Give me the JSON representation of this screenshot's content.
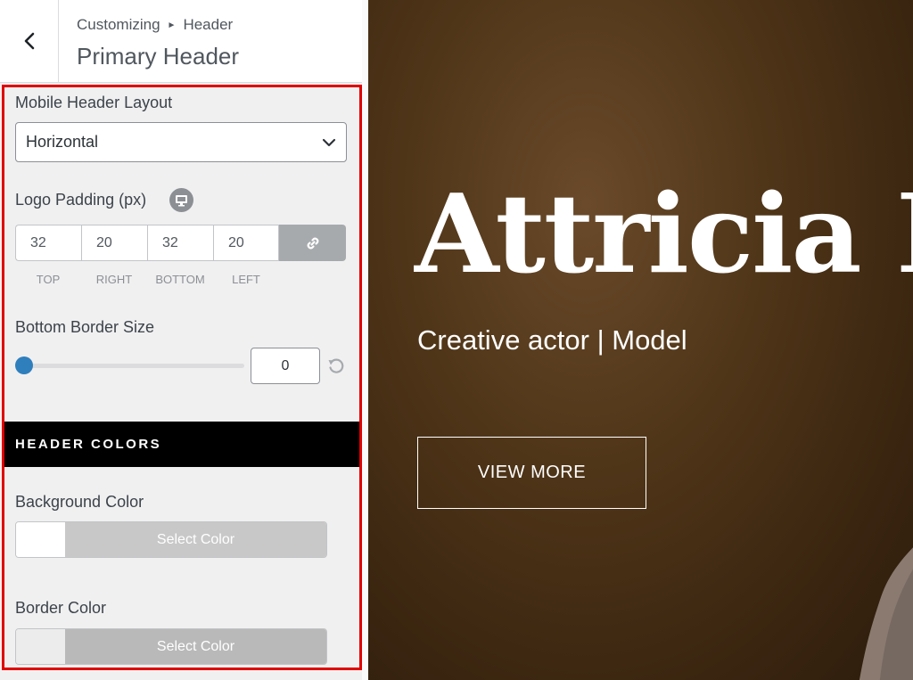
{
  "header": {
    "breadcrumb": [
      "Customizing",
      "Header"
    ],
    "title": "Primary Header"
  },
  "mobile_layout": {
    "label": "Mobile Header Layout",
    "value": "Horizontal"
  },
  "logo_padding": {
    "label": "Logo Padding (px)",
    "top": "32",
    "right": "20",
    "bottom": "32",
    "left": "20",
    "labels": [
      "TOP",
      "RIGHT",
      "BOTTOM",
      "LEFT"
    ]
  },
  "border_size": {
    "label": "Bottom Border Size",
    "value": "0",
    "slider_fraction": 0
  },
  "section": {
    "title": "HEADER COLORS"
  },
  "background_color": {
    "label": "Background Color",
    "button": "Select Color",
    "swatch": "#ffffff",
    "bar_color": "#c8c8c8"
  },
  "border_color": {
    "label": "Border Color",
    "button": "Select Color",
    "swatch": "#ececec",
    "bar_color": "#b9b9b9"
  },
  "preview": {
    "title": "Attricia Ke",
    "subtitle": "Creative actor | Model",
    "button": "VIEW MORE"
  },
  "colors": {
    "highlight": "#e00000",
    "slider_accent": "#2f7fbd",
    "section_bg": "#000000"
  }
}
